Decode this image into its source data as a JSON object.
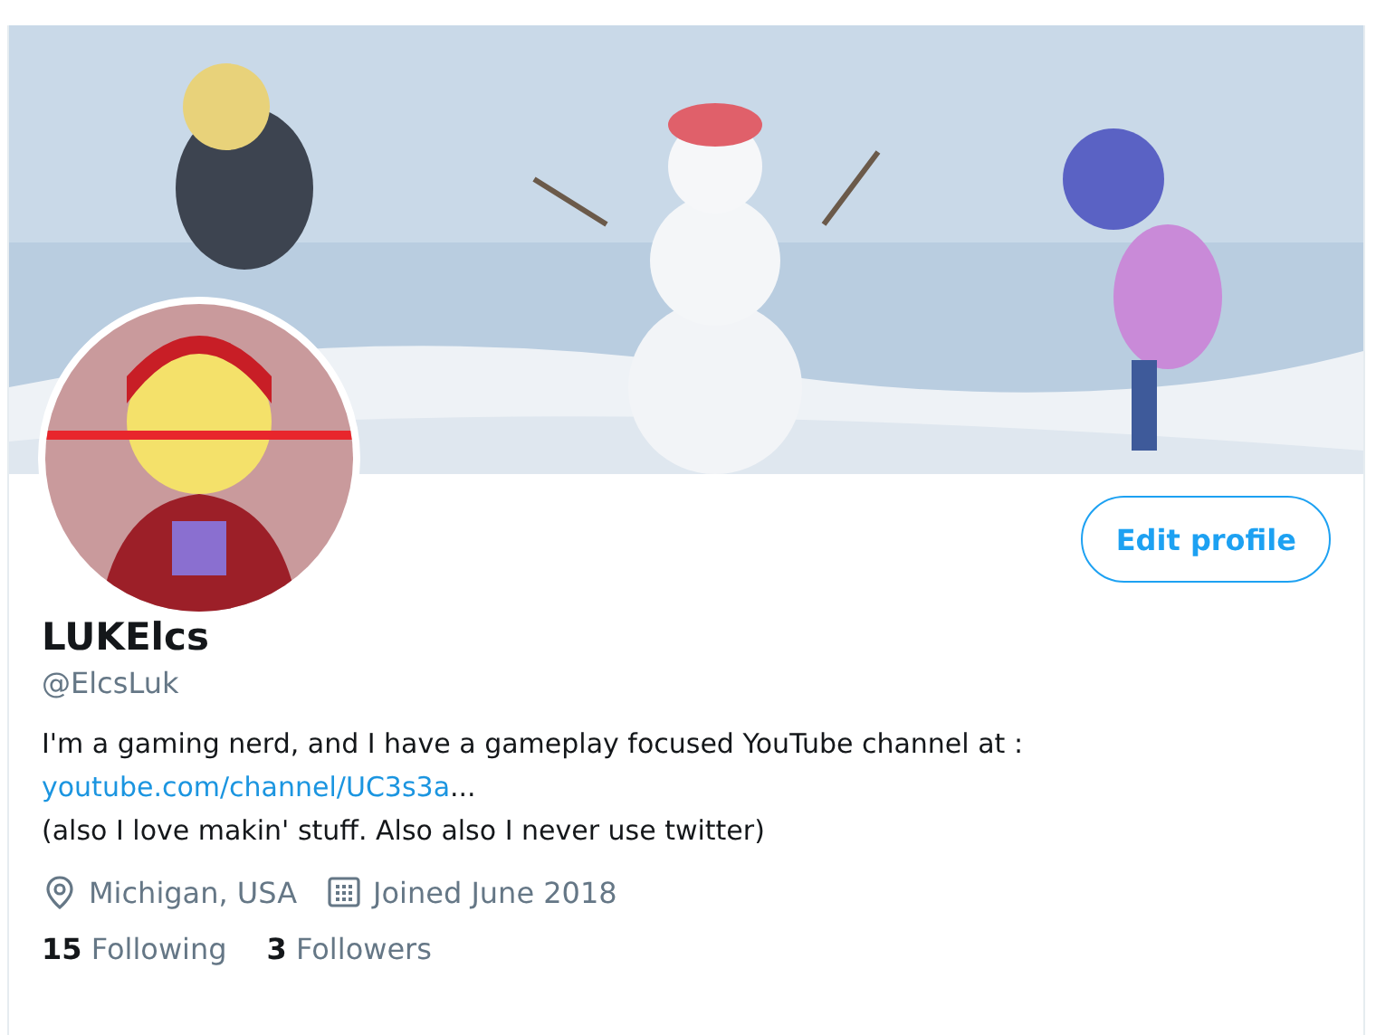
{
  "profile": {
    "name": "LUKElcs",
    "handle": "@ElcsLuk",
    "bio": {
      "before": "I'm a gaming nerd, and I have a gameplay focused YouTube channel at :\n",
      "link": "youtube.com/channel/UC3s3a",
      "link_suffix": "...",
      "after": "\n(also I love makin' stuff.  Also also I never use twitter)"
    },
    "location": "Michigan, USA",
    "joined": "Joined June 2018",
    "stats": [
      {
        "count": "15",
        "label": "Following"
      },
      {
        "count": "3",
        "label": "Followers"
      }
    ]
  },
  "edit_button": "Edit profile"
}
